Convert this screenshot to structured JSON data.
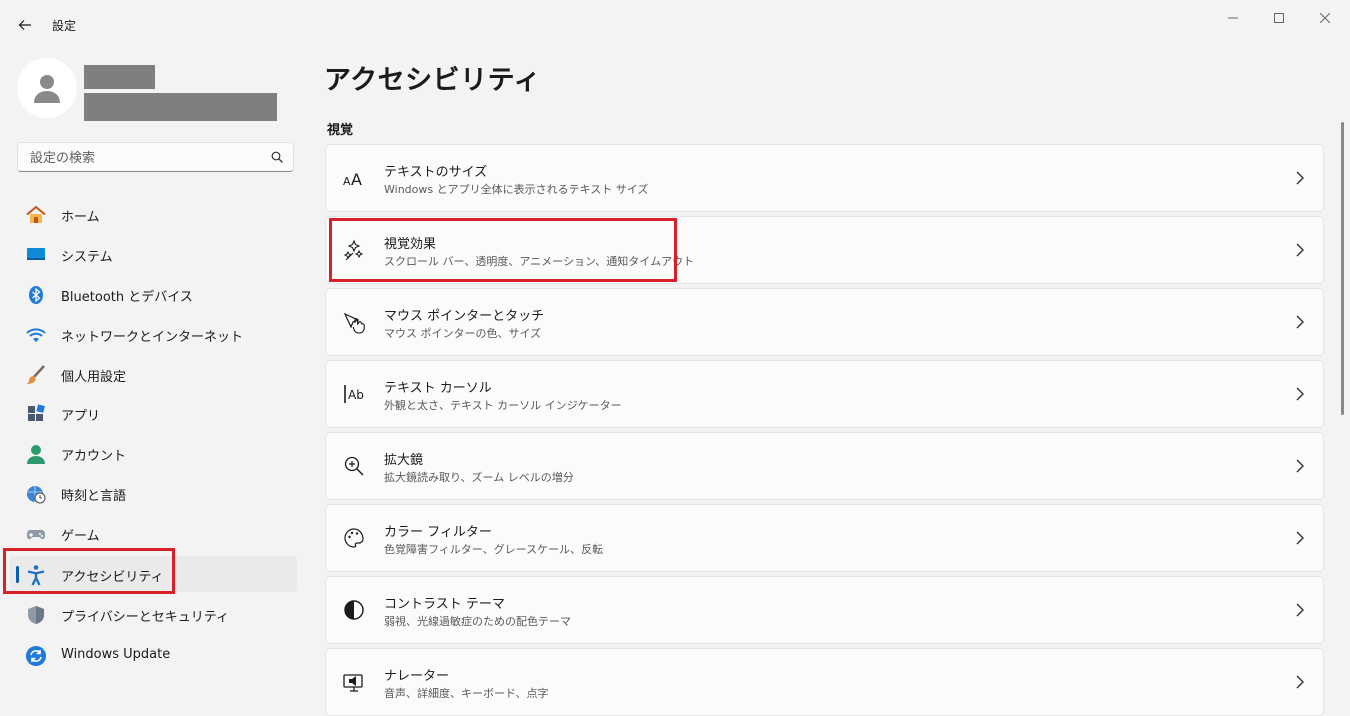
{
  "window": {
    "title": "設定"
  },
  "search": {
    "placeholder": "設定の検索"
  },
  "sidebar": {
    "items": [
      {
        "label": "ホーム"
      },
      {
        "label": "システム"
      },
      {
        "label": "Bluetooth とデバイス"
      },
      {
        "label": "ネットワークとインターネット"
      },
      {
        "label": "個人用設定"
      },
      {
        "label": "アプリ"
      },
      {
        "label": "アカウント"
      },
      {
        "label": "時刻と言語"
      },
      {
        "label": "ゲーム"
      },
      {
        "label": "アクセシビリティ"
      },
      {
        "label": "プライバシーとセキュリティ"
      },
      {
        "label": "Windows Update"
      }
    ],
    "active": "アクセシビリティ"
  },
  "main": {
    "title": "アクセシビリティ",
    "section": "視覚",
    "cards": [
      {
        "title": "テキストのサイズ",
        "subtitle": "Windows とアプリ全体に表示されるテキスト サイズ",
        "icon": "text-size-icon"
      },
      {
        "title": "視覚効果",
        "subtitle": "スクロール バー、透明度、アニメーション、通知タイムアウト",
        "icon": "visual-effects-icon"
      },
      {
        "title": "マウス ポインターとタッチ",
        "subtitle": "マウス ポインターの色、サイズ",
        "icon": "mouse-pointer-icon"
      },
      {
        "title": "テキスト カーソル",
        "subtitle": "外観と太さ、テキスト カーソル インジケーター",
        "icon": "text-cursor-icon"
      },
      {
        "title": "拡大鏡",
        "subtitle": "拡大鏡読み取り、ズーム レベルの増分",
        "icon": "magnifier-icon"
      },
      {
        "title": "カラー フィルター",
        "subtitle": "色覚障害フィルター、グレースケール、反転",
        "icon": "palette-icon"
      },
      {
        "title": "コントラスト テーマ",
        "subtitle": "弱視、光線過敏症のための配色テーマ",
        "icon": "contrast-icon"
      },
      {
        "title": "ナレーター",
        "subtitle": "音声、詳細度、キーボード、点字",
        "icon": "narrator-icon"
      }
    ]
  },
  "colors": {
    "accent": "#005fb8",
    "highlight": "#d6202a",
    "background": "#f3f3f3",
    "card": "#fbfbfb"
  }
}
